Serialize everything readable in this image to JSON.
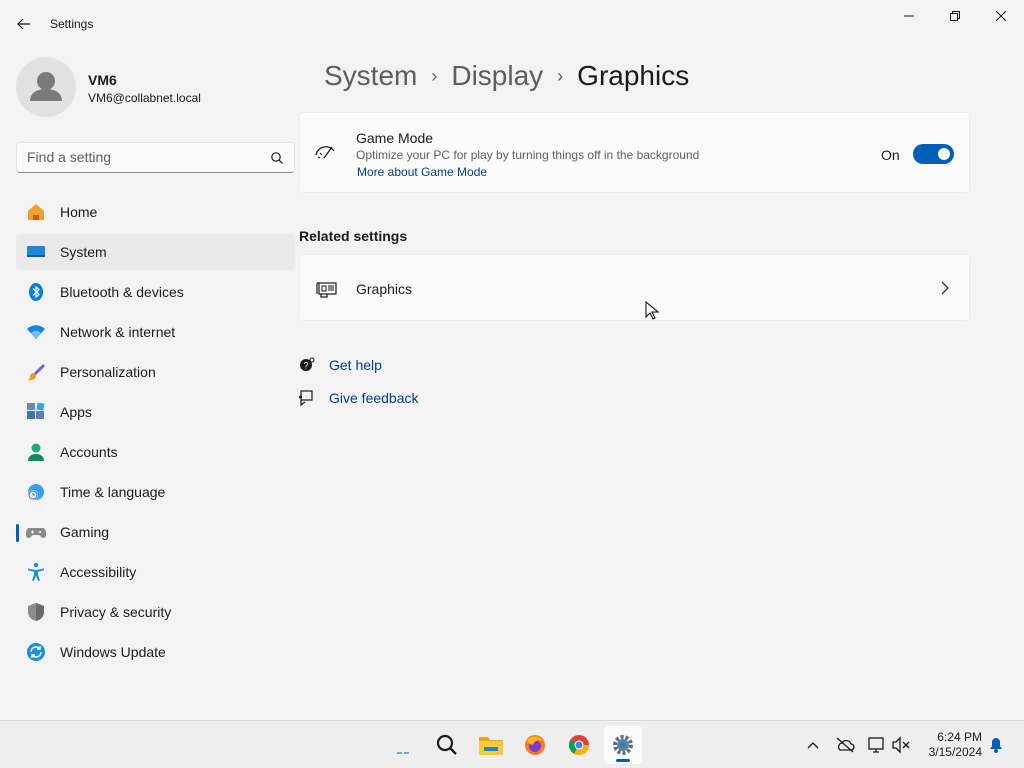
{
  "window": {
    "title": "Settings"
  },
  "profile": {
    "name": "VM6",
    "email": "VM6@collabnet.local"
  },
  "search": {
    "placeholder": "Find a setting"
  },
  "sidebar": {
    "items": [
      {
        "label": "Home",
        "icon": "home-icon"
      },
      {
        "label": "System",
        "icon": "system-icon"
      },
      {
        "label": "Bluetooth & devices",
        "icon": "bluetooth-icon"
      },
      {
        "label": "Network & internet",
        "icon": "wifi-icon"
      },
      {
        "label": "Personalization",
        "icon": "brush-icon"
      },
      {
        "label": "Apps",
        "icon": "apps-icon"
      },
      {
        "label": "Accounts",
        "icon": "accounts-icon"
      },
      {
        "label": "Time & language",
        "icon": "globe-clock-icon"
      },
      {
        "label": "Gaming",
        "icon": "gamepad-icon"
      },
      {
        "label": "Accessibility",
        "icon": "accessibility-icon"
      },
      {
        "label": "Privacy & security",
        "icon": "shield-icon"
      },
      {
        "label": "Windows Update",
        "icon": "update-icon"
      }
    ]
  },
  "breadcrumb": {
    "level1": "System",
    "level2": "Display",
    "current": "Graphics"
  },
  "game_mode": {
    "title": "Game Mode",
    "description": "Optimize your PC for play by turning things off in the background",
    "link": "More about Game Mode",
    "state_label": "On",
    "enabled": true
  },
  "related": {
    "heading": "Related settings",
    "graphics_label": "Graphics"
  },
  "help": {
    "get_help": "Get help",
    "give_feedback": "Give feedback"
  },
  "taskbar": {
    "time": "6:24 PM",
    "date": "3/15/2024"
  },
  "colors": {
    "accent": "#005fb8",
    "link": "#003e92",
    "background": "#f3f3f3",
    "card": "#fbfbfb"
  }
}
